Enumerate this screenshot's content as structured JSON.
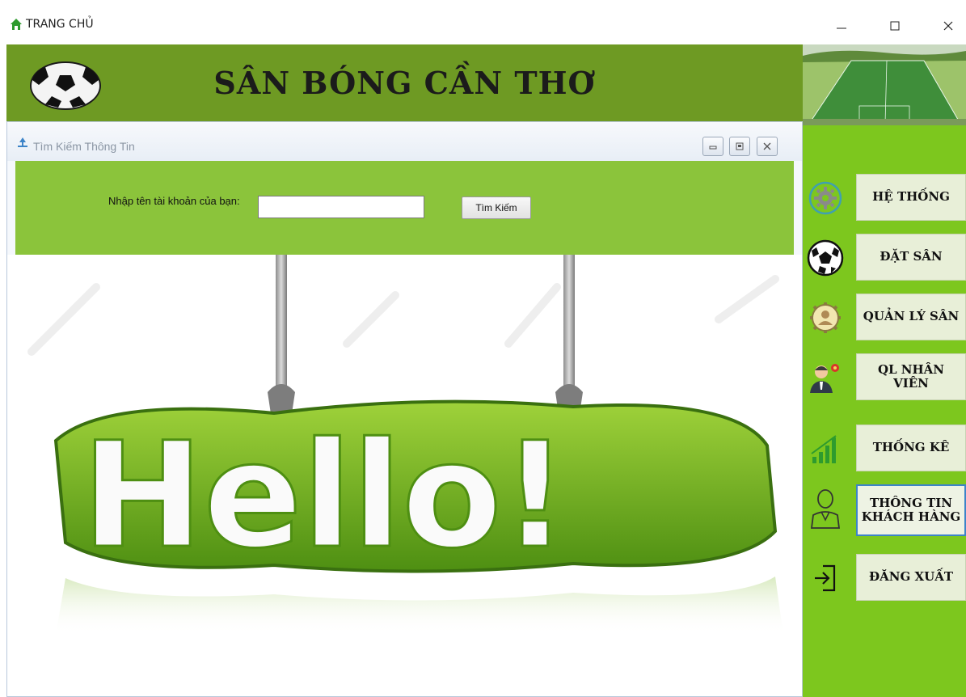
{
  "window": {
    "title": "TRANG CHỦ",
    "controls": {
      "minimize": "–",
      "maximize": "☐",
      "close": "X"
    }
  },
  "header": {
    "title": "SÂN BÓNG CẦN THƠ",
    "logo_icon": "soccer-ball-icon",
    "photo": "soccer-field-photo"
  },
  "child_window": {
    "title": "Tìm Kiếm Thông Tin",
    "icon": "tree-icon",
    "search": {
      "label": "Nhập tên tài khoản của bạn:",
      "value": "",
      "button_label": "Tìm Kiếm"
    },
    "banner_text": "Hello!"
  },
  "sidebar": {
    "items": [
      {
        "label": "HỆ THỐNG",
        "icon": "gear-refresh-icon",
        "active": false
      },
      {
        "label": "ĐẶT SÂN",
        "icon": "soccer-ball-icon",
        "active": false
      },
      {
        "label": "QUẢN LÝ SÂN",
        "icon": "user-gear-icon",
        "active": false
      },
      {
        "label": "QL NHÂN VIÊN",
        "icon": "staff-manager-icon",
        "active": false
      },
      {
        "label": "THỐNG KÊ",
        "icon": "bar-chart-icon",
        "active": false
      },
      {
        "label": "THÔNG TIN\nKHÁCH HÀNG",
        "icon": "customer-icon",
        "active": true
      },
      {
        "label": "ĐĂNG XUẤT",
        "icon": "logout-icon",
        "active": false
      }
    ]
  },
  "colors": {
    "header_bg": "#6e9a23",
    "sidebar_bg": "#7dc71e",
    "search_band_bg": "#8bc43b",
    "active_border": "#3d84c8"
  }
}
